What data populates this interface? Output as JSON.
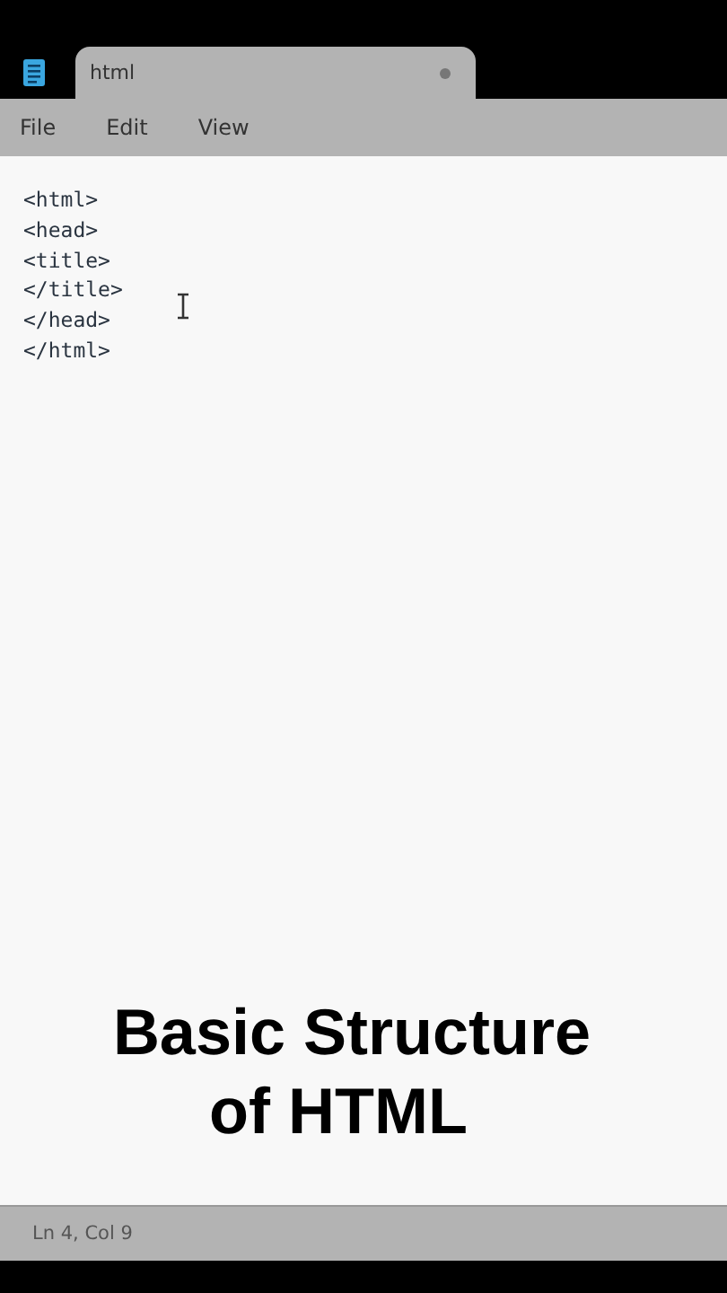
{
  "tab": {
    "title": "html",
    "modified": true
  },
  "menu": [
    "File",
    "Edit",
    "View"
  ],
  "editor": {
    "lines": [
      "<html>",
      "<head>",
      "<title>",
      "</title>",
      "</head>",
      "</html>"
    ]
  },
  "caption": [
    "Basic Structure",
    "of HTML"
  ],
  "status_bar": {
    "position": "Ln 4, Col 9"
  }
}
